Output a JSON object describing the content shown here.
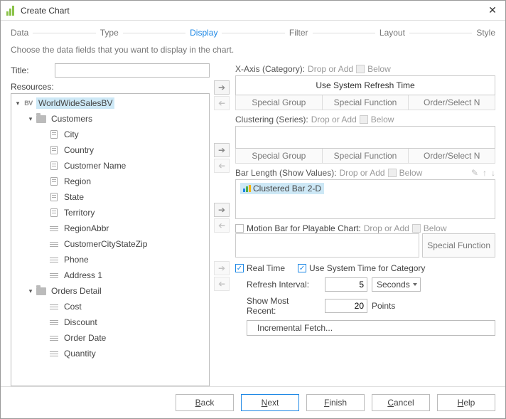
{
  "window": {
    "title": "Create Chart"
  },
  "wizard": {
    "steps": [
      "Data",
      "Type",
      "Display",
      "Filter",
      "Layout",
      "Style"
    ],
    "active_index": 2,
    "subtitle": "Choose the data fields that you want to display in the chart."
  },
  "left": {
    "title_label": "Title:",
    "title_value": "",
    "resources_label": "Resources:",
    "tree": [
      {
        "indent": 0,
        "caret": "▾",
        "icon": "bv",
        "label": "WorldWideSalesBV",
        "selected": true
      },
      {
        "indent": 1,
        "caret": "▾",
        "icon": "folder",
        "label": "Customers"
      },
      {
        "indent": 2,
        "caret": "",
        "icon": "tag",
        "label": "City"
      },
      {
        "indent": 2,
        "caret": "",
        "icon": "tag",
        "label": "Country"
      },
      {
        "indent": 2,
        "caret": "",
        "icon": "tag",
        "label": "Customer Name"
      },
      {
        "indent": 2,
        "caret": "",
        "icon": "tag",
        "label": "Region"
      },
      {
        "indent": 2,
        "caret": "",
        "icon": "tag",
        "label": "State"
      },
      {
        "indent": 2,
        "caret": "",
        "icon": "tag",
        "label": "Territory"
      },
      {
        "indent": 2,
        "caret": "",
        "icon": "lines",
        "label": "RegionAbbr"
      },
      {
        "indent": 2,
        "caret": "",
        "icon": "lines",
        "label": "CustomerCityStateZip"
      },
      {
        "indent": 2,
        "caret": "",
        "icon": "lines",
        "label": "Phone"
      },
      {
        "indent": 2,
        "caret": "",
        "icon": "lines",
        "label": "Address 1"
      },
      {
        "indent": 1,
        "caret": "▾",
        "icon": "folder",
        "label": "Orders Detail"
      },
      {
        "indent": 2,
        "caret": "",
        "icon": "lines",
        "label": "Cost"
      },
      {
        "indent": 2,
        "caret": "",
        "icon": "lines",
        "label": "Discount"
      },
      {
        "indent": 2,
        "caret": "",
        "icon": "lines",
        "label": "Order Date"
      },
      {
        "indent": 2,
        "caret": "",
        "icon": "lines",
        "label": "Quantity"
      }
    ]
  },
  "right": {
    "xaxis": {
      "label": "X-Axis (Category):",
      "hint_left": "Drop or Add",
      "hint_right": "Below",
      "content": "Use System Refresh Time"
    },
    "tabs1": [
      "Special Group",
      "Special Function",
      "Order/Select N"
    ],
    "clustering": {
      "label": "Clustering (Series):",
      "hint_left": "Drop or Add",
      "hint_right": "Below"
    },
    "tabs2": [
      "Special Group",
      "Special Function",
      "Order/Select N"
    ],
    "barlen": {
      "label": "Bar Length (Show Values):",
      "hint_left": "Drop or Add",
      "hint_right": "Below",
      "chip": "Clustered Bar 2-D"
    },
    "motion": {
      "label": "Motion Bar for Playable Chart:",
      "hint_left": "Drop or Add",
      "hint_right": "Below",
      "sf_label": "Special Function"
    },
    "realtime_label": "Real Time",
    "useSystem_label": "Use System Time for Category",
    "refresh": {
      "label": "Refresh Interval:",
      "value": "5",
      "unit": "Seconds"
    },
    "recent": {
      "label": "Show Most Recent:",
      "value": "20",
      "unit": "Points"
    },
    "incremental": "Incremental Fetch..."
  },
  "buttons": {
    "back": "Back",
    "next": "Next",
    "finish": "Finish",
    "cancel": "Cancel",
    "help": "Help"
  }
}
